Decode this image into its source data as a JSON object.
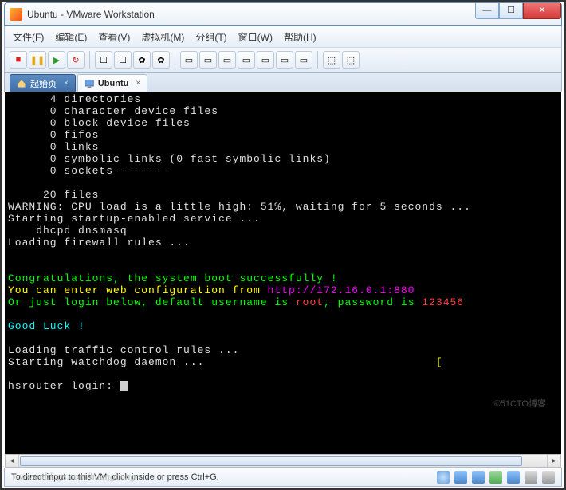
{
  "window": {
    "title": "Ubuntu - VMware Workstation"
  },
  "menu": {
    "file": "文件(F)",
    "edit": "编辑(E)",
    "view": "查看(V)",
    "vm": "虚拟机(M)",
    "tabs": "分组(T)",
    "window": "窗口(W)",
    "help": "帮助(H)"
  },
  "toolbar": {
    "poweroff": "■",
    "pause": "❚❚",
    "play": "▶",
    "reset": "↻",
    "snap": "☐",
    "snapmgr": "☐",
    "screenshot": "✿",
    "settings": "✿",
    "winA": "▭",
    "winB": "▭",
    "winC": "▭",
    "winD": "▭",
    "winE": "▭",
    "winF": "▭",
    "winG": "▭",
    "unity": "⬚",
    "fullscr": "⬚"
  },
  "tabs": {
    "home_label": "起始页",
    "active_label": "Ubuntu",
    "close": "×"
  },
  "terminal": {
    "l1": "      4 directories",
    "l2": "      0 character device files",
    "l3": "      0 block device files",
    "l4": "      0 fifos",
    "l5": "      0 links",
    "l6": "      0 symbolic links (0 fast symbolic links)",
    "l7": "      0 sockets--------",
    "l8": "",
    "l9": "     20 files",
    "l10": "WARNING: CPU load is a little high: 51%, waiting for 5 seconds ...",
    "l11": "Starting startup-enabled service ...",
    "l12": "    dhcpd dnsmasq",
    "l13": "Loading firewall rules ...",
    "l14": "",
    "l15": "",
    "c1": "Congratulations, the system boot successfully !",
    "c2a": "You can enter web configuration from ",
    "c2b": "http://172.16.0.1:880",
    "c3a": "Or just login below, default username is ",
    "c3b": "root",
    "c3c": ", password is ",
    "c3d": "123456",
    "l19": "",
    "gl": "Good Luck !",
    "l21": "",
    "l22": "Loading traffic control rules ...",
    "l23a": "Starting watchdog daemon ...",
    "l23b": "                                 [",
    "l24": "",
    "login": "hsrouter login: "
  },
  "status": {
    "hint": "To direct input to this VM, click inside or press Ctrl+G."
  },
  "watermark": "www.cnblogs.com/huangcong",
  "watermark2": "©51CTO博客"
}
